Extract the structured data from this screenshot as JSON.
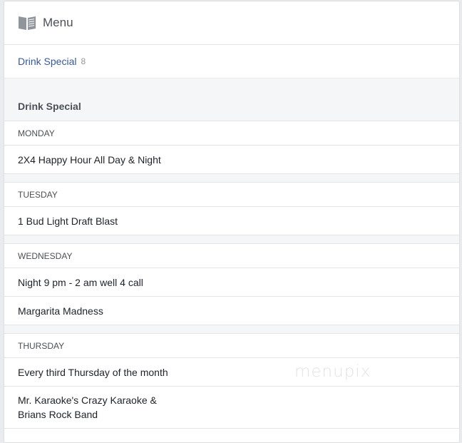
{
  "header": {
    "icon": "book-icon",
    "title": "Menu"
  },
  "categories": [
    {
      "label": "Drink Special",
      "count": "8"
    }
  ],
  "section": {
    "title": "Drink Special",
    "days": [
      {
        "name": "MONDAY",
        "items": [
          "2X4 Happy Hour All Day & Night"
        ]
      },
      {
        "name": "TUESDAY",
        "items": [
          "1 Bud Light Draft Blast"
        ]
      },
      {
        "name": "WEDNESDAY",
        "items": [
          "Night 9 pm - 2 am well 4 call",
          "Margarita Madness"
        ]
      },
      {
        "name": "THURSDAY",
        "items": [
          "Every third Thursday of the month",
          "Mr. Karaoke's Crazy Karaoke &\nBrians Rock Band"
        ]
      }
    ]
  },
  "watermark": "menupix",
  "colors": {
    "link": "#365899",
    "section_bg": "#f5f6f7",
    "page_bg": "#e9ebee"
  }
}
